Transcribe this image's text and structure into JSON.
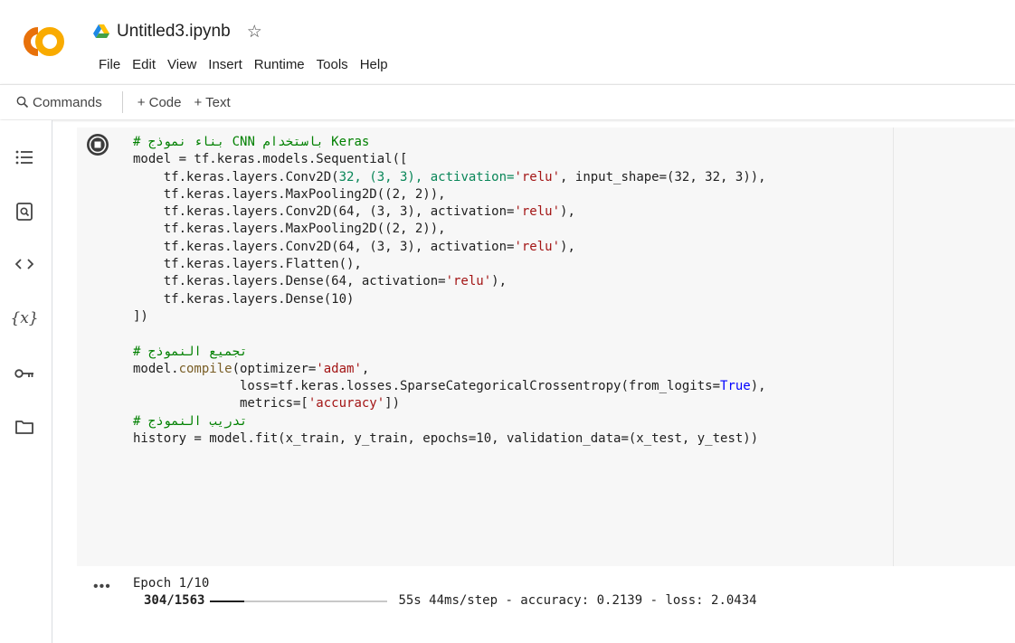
{
  "app": {
    "file_name": "Untitled3.ipynb",
    "star": "☆",
    "brand_colors": {
      "logo_orange": "#f9ab00",
      "logo_dark_orange": "#e8710a"
    }
  },
  "menu": [
    "File",
    "Edit",
    "View",
    "Insert",
    "Runtime",
    "Tools",
    "Help"
  ],
  "toolbar": {
    "commands_label": "Commands",
    "code_label": "+ Code",
    "text_label": "+ Text"
  },
  "left_rail": [
    "toc-icon",
    "find-icon",
    "code-snippets-icon",
    "variables-icon",
    "secrets-key-icon",
    "files-folder-icon"
  ],
  "cell": {
    "comment_1": "# بناء نموذج CNN باستخدام Keras",
    "line_2": "model = tf.keras.models.Sequential([",
    "line_3a": "    tf.keras.layers.Conv2D(",
    "line_3_args": "32, (3, 3), activation=",
    "line_3_str": "'relu'",
    "line_3_rest": ", input_shape=(32, 32, 3)),",
    "line_4": "    tf.keras.layers.MaxPooling2D((2, 2)),",
    "line_5a": "    tf.keras.layers.Conv2D(64, (3, 3), activation=",
    "line_5_str": "'relu'",
    "line_5_end": "),",
    "line_6": "    tf.keras.layers.MaxPooling2D((2, 2)),",
    "line_7a": "    tf.keras.layers.Conv2D(64, (3, 3), activation=",
    "line_7_str": "'relu'",
    "line_7_end": "),",
    "line_8": "    tf.keras.layers.Flatten(),",
    "line_9a": "    tf.keras.layers.Dense(64, activation=",
    "line_9_str": "'relu'",
    "line_9_end": "),",
    "line_10": "    tf.keras.layers.Dense(10)",
    "line_11": "])",
    "comment_2": "# تجميع النموذج",
    "line_13a": "model.",
    "line_13_fn": "compile",
    "line_13b": "(optimizer=",
    "line_13_str": "'adam'",
    "line_13_end": ",",
    "line_14a": "              loss=tf.keras.losses.SparseCategoricalCrossentropy(from_logits=",
    "line_14_true": "True",
    "line_14_end": "),",
    "line_15a": "              metrics=[",
    "line_15_str": "'accuracy'",
    "line_15_end": "])",
    "comment_3": "# تدريب النموذج",
    "line_17": "history = model.fit(x_train, y_train, epochs=10, validation_data=(x_test, y_test))"
  },
  "output": {
    "dots": "•••",
    "epoch": "Epoch 1/10",
    "step_count": "304/1563",
    "progress_fraction": 0.19,
    "stats": "55s 44ms/step - accuracy: 0.2139 - loss: 2.0434"
  }
}
